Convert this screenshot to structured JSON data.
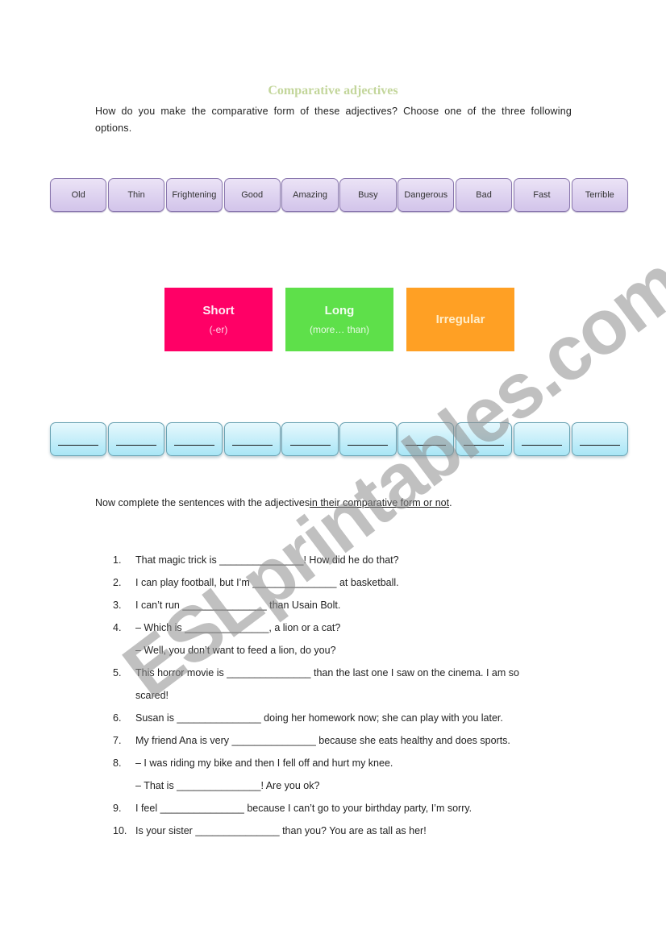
{
  "title": "Comparative adjectives",
  "intro": "How do you make the comparative form of these adjectives? Choose one of the three following options.",
  "adjectives": [
    "Old",
    "Thin",
    "Frightening",
    "Good",
    "Amazing",
    "Busy",
    "Dangerous",
    "Bad",
    "Fast",
    "Terrible"
  ],
  "categories": [
    {
      "name": "Short",
      "rule": "(-er)",
      "color": "#ff0066"
    },
    {
      "name": "Long",
      "rule": "(more… than)",
      "color": "#5ee04a"
    },
    {
      "name": "Irregular",
      "rule": "",
      "color": "#ffa024"
    }
  ],
  "answer_boxes": [
    "",
    "",
    "",
    "",
    "",
    "",
    "",
    "",
    "",
    ""
  ],
  "instruction": {
    "before": "Now complete the sentences with the adjectives",
    "underlined": "in their comparative form or not",
    "after": "."
  },
  "sentences": [
    {
      "num": "1.",
      "text": "That magic trick is _______________! How did he do that?"
    },
    {
      "num": "2.",
      "text": "I can play football, but I’m _______________ at basketball."
    },
    {
      "num": "3.",
      "text": "I can’t run _______________ than Usain Bolt."
    },
    {
      "num": "4.",
      "text": "– Which is _______________,  a lion or a cat?"
    },
    {
      "num": "",
      "text": "– Well, you don’t want to feed a lion, do you?"
    },
    {
      "num": "5.",
      "text": "This horror movie is _______________ than the last one I saw on the cinema. I am so"
    },
    {
      "num": "",
      "text": "scared!"
    },
    {
      "num": "6.",
      "text": "Susan is _______________ doing her homework now; she can play with you later."
    },
    {
      "num": "7.",
      "text": "My friend Ana is very _______________ because she eats healthy and does sports."
    },
    {
      "num": "8.",
      "text": "– I was riding my bike and then I fell off and hurt my knee."
    },
    {
      "num": "",
      "text": "– That is _______________! Are you ok?"
    },
    {
      "num": "9.",
      "text": "I feel _______________ because I can’t go to your birthday party, I’m sorry."
    },
    {
      "num": "10.",
      "text": "Is your sister _______________ than you? You are as tall as her!"
    }
  ],
  "watermark": "ESLprintables.com"
}
